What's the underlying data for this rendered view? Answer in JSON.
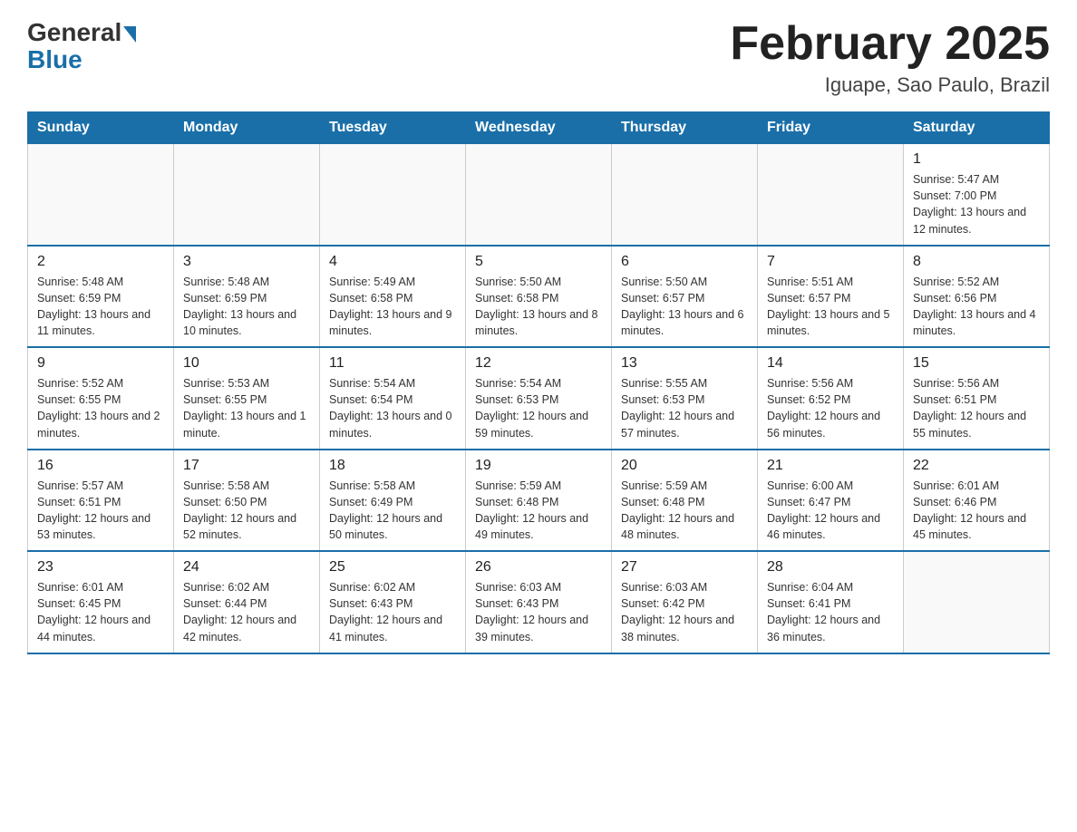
{
  "header": {
    "logo_general": "General",
    "logo_blue": "Blue",
    "title": "February 2025",
    "subtitle": "Iguape, Sao Paulo, Brazil"
  },
  "days_of_week": [
    "Sunday",
    "Monday",
    "Tuesday",
    "Wednesday",
    "Thursday",
    "Friday",
    "Saturday"
  ],
  "weeks": [
    [
      {
        "day": "",
        "info": ""
      },
      {
        "day": "",
        "info": ""
      },
      {
        "day": "",
        "info": ""
      },
      {
        "day": "",
        "info": ""
      },
      {
        "day": "",
        "info": ""
      },
      {
        "day": "",
        "info": ""
      },
      {
        "day": "1",
        "info": "Sunrise: 5:47 AM\nSunset: 7:00 PM\nDaylight: 13 hours and 12 minutes."
      }
    ],
    [
      {
        "day": "2",
        "info": "Sunrise: 5:48 AM\nSunset: 6:59 PM\nDaylight: 13 hours and 11 minutes."
      },
      {
        "day": "3",
        "info": "Sunrise: 5:48 AM\nSunset: 6:59 PM\nDaylight: 13 hours and 10 minutes."
      },
      {
        "day": "4",
        "info": "Sunrise: 5:49 AM\nSunset: 6:58 PM\nDaylight: 13 hours and 9 minutes."
      },
      {
        "day": "5",
        "info": "Sunrise: 5:50 AM\nSunset: 6:58 PM\nDaylight: 13 hours and 8 minutes."
      },
      {
        "day": "6",
        "info": "Sunrise: 5:50 AM\nSunset: 6:57 PM\nDaylight: 13 hours and 6 minutes."
      },
      {
        "day": "7",
        "info": "Sunrise: 5:51 AM\nSunset: 6:57 PM\nDaylight: 13 hours and 5 minutes."
      },
      {
        "day": "8",
        "info": "Sunrise: 5:52 AM\nSunset: 6:56 PM\nDaylight: 13 hours and 4 minutes."
      }
    ],
    [
      {
        "day": "9",
        "info": "Sunrise: 5:52 AM\nSunset: 6:55 PM\nDaylight: 13 hours and 2 minutes."
      },
      {
        "day": "10",
        "info": "Sunrise: 5:53 AM\nSunset: 6:55 PM\nDaylight: 13 hours and 1 minute."
      },
      {
        "day": "11",
        "info": "Sunrise: 5:54 AM\nSunset: 6:54 PM\nDaylight: 13 hours and 0 minutes."
      },
      {
        "day": "12",
        "info": "Sunrise: 5:54 AM\nSunset: 6:53 PM\nDaylight: 12 hours and 59 minutes."
      },
      {
        "day": "13",
        "info": "Sunrise: 5:55 AM\nSunset: 6:53 PM\nDaylight: 12 hours and 57 minutes."
      },
      {
        "day": "14",
        "info": "Sunrise: 5:56 AM\nSunset: 6:52 PM\nDaylight: 12 hours and 56 minutes."
      },
      {
        "day": "15",
        "info": "Sunrise: 5:56 AM\nSunset: 6:51 PM\nDaylight: 12 hours and 55 minutes."
      }
    ],
    [
      {
        "day": "16",
        "info": "Sunrise: 5:57 AM\nSunset: 6:51 PM\nDaylight: 12 hours and 53 minutes."
      },
      {
        "day": "17",
        "info": "Sunrise: 5:58 AM\nSunset: 6:50 PM\nDaylight: 12 hours and 52 minutes."
      },
      {
        "day": "18",
        "info": "Sunrise: 5:58 AM\nSunset: 6:49 PM\nDaylight: 12 hours and 50 minutes."
      },
      {
        "day": "19",
        "info": "Sunrise: 5:59 AM\nSunset: 6:48 PM\nDaylight: 12 hours and 49 minutes."
      },
      {
        "day": "20",
        "info": "Sunrise: 5:59 AM\nSunset: 6:48 PM\nDaylight: 12 hours and 48 minutes."
      },
      {
        "day": "21",
        "info": "Sunrise: 6:00 AM\nSunset: 6:47 PM\nDaylight: 12 hours and 46 minutes."
      },
      {
        "day": "22",
        "info": "Sunrise: 6:01 AM\nSunset: 6:46 PM\nDaylight: 12 hours and 45 minutes."
      }
    ],
    [
      {
        "day": "23",
        "info": "Sunrise: 6:01 AM\nSunset: 6:45 PM\nDaylight: 12 hours and 44 minutes."
      },
      {
        "day": "24",
        "info": "Sunrise: 6:02 AM\nSunset: 6:44 PM\nDaylight: 12 hours and 42 minutes."
      },
      {
        "day": "25",
        "info": "Sunrise: 6:02 AM\nSunset: 6:43 PM\nDaylight: 12 hours and 41 minutes."
      },
      {
        "day": "26",
        "info": "Sunrise: 6:03 AM\nSunset: 6:43 PM\nDaylight: 12 hours and 39 minutes."
      },
      {
        "day": "27",
        "info": "Sunrise: 6:03 AM\nSunset: 6:42 PM\nDaylight: 12 hours and 38 minutes."
      },
      {
        "day": "28",
        "info": "Sunrise: 6:04 AM\nSunset: 6:41 PM\nDaylight: 12 hours and 36 minutes."
      },
      {
        "day": "",
        "info": ""
      }
    ]
  ]
}
